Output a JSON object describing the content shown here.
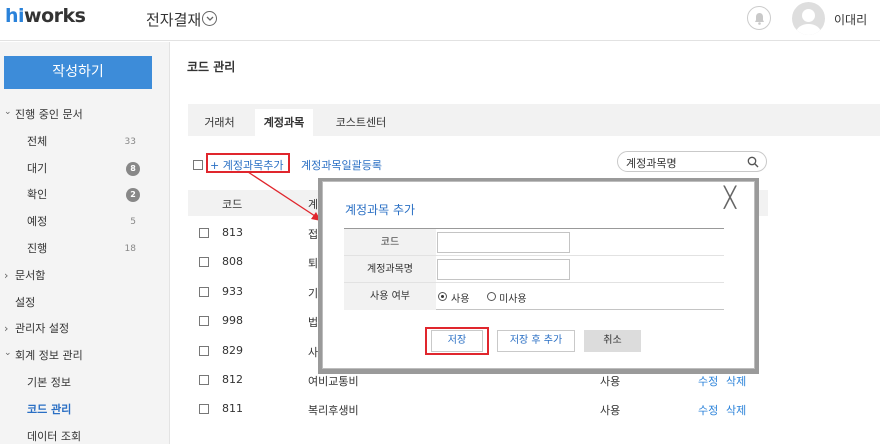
{
  "header": {
    "logo_hi": "hi",
    "logo_works": "works",
    "app_title": "전자결재",
    "username": "이대리"
  },
  "sidebar": {
    "write_button": "작성하기",
    "items": [
      {
        "label": "진행 중인 문서",
        "kind": "top",
        "expanded": true
      },
      {
        "label": "전체",
        "kind": "sub",
        "count": "33"
      },
      {
        "label": "대기",
        "kind": "sub",
        "badge": "8"
      },
      {
        "label": "확인",
        "kind": "sub",
        "badge": "2"
      },
      {
        "label": "예정",
        "kind": "sub",
        "count": "5"
      },
      {
        "label": "진행",
        "kind": "sub",
        "count": "18"
      },
      {
        "label": "문서함",
        "kind": "top",
        "expanded": false
      },
      {
        "label": "설정",
        "kind": "plain"
      },
      {
        "label": "관리자 설정",
        "kind": "top",
        "expanded": false
      },
      {
        "label": "회계 정보 관리",
        "kind": "top",
        "expanded": true
      },
      {
        "label": "기본 정보",
        "kind": "sub"
      },
      {
        "label": "코드 관리",
        "kind": "sub",
        "active": true
      },
      {
        "label": "데이터 조회",
        "kind": "sub"
      }
    ]
  },
  "main": {
    "page_title": "코드 관리",
    "tabs": [
      "거래처",
      "계정과목",
      "코스트센터"
    ],
    "active_tab": 1,
    "add_link": "+ 계정과목추가",
    "bulk_link": "계정과목일괄등록",
    "search_value": "계정과목명",
    "table_header": {
      "code": "코드",
      "name": "계"
    },
    "rows": [
      {
        "code": "813",
        "name": "접",
        "use": "",
        "edit": "",
        "delete": ""
      },
      {
        "code": "808",
        "name": "퇴",
        "use": "",
        "edit": "",
        "delete": ""
      },
      {
        "code": "933",
        "name": "기",
        "use": "",
        "edit": "",
        "delete": ""
      },
      {
        "code": "998",
        "name": "법",
        "use": "",
        "edit": "",
        "delete": ""
      },
      {
        "code": "829",
        "name": "사",
        "use": "",
        "edit": "",
        "delete": ""
      },
      {
        "code": "812",
        "name": "여비교통비",
        "use": "사용",
        "edit": "수정",
        "delete": "삭제"
      },
      {
        "code": "811",
        "name": "복리후생비",
        "use": "사용",
        "edit": "수정",
        "delete": "삭제"
      }
    ]
  },
  "modal": {
    "title": "계정과목 추가",
    "close_glyph": "╳",
    "fields": {
      "code_label": "코드",
      "name_label": "계정과목명",
      "use_label": "사용 여부",
      "code_value": "",
      "name_value": ""
    },
    "radio_use": "사용",
    "radio_unused": "미사용",
    "save_button": "저장",
    "save_add_button": "저장 후 추가",
    "cancel_button": "취소"
  },
  "colors": {
    "accent": "#3d8cd9",
    "link": "#2a6fc4",
    "highlight": "#e0262d"
  }
}
